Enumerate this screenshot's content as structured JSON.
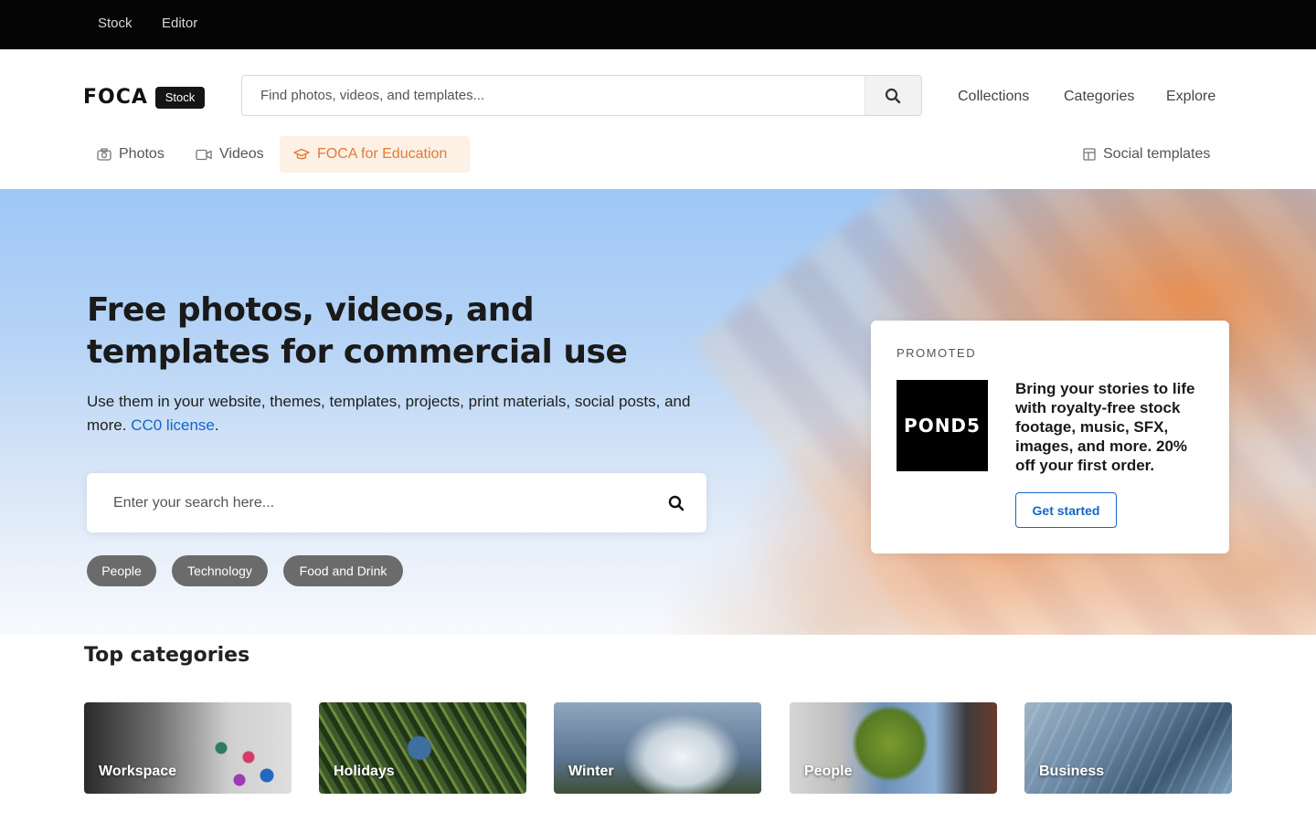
{
  "topbar": {
    "links": [
      "Stock",
      "Editor"
    ]
  },
  "header": {
    "logo": "FOCA",
    "logo_badge": "Stock",
    "search_placeholder": "Find photos, videos, and templates...",
    "nav": [
      "Collections",
      "Categories",
      "Explore"
    ],
    "subnav": {
      "photos": "Photos",
      "videos": "Videos",
      "education": "FOCA for Education",
      "social": "Social templates"
    }
  },
  "hero": {
    "title": "Free photos, videos, and templates for commercial use",
    "subtitle": "Use them in your website, themes, templates, projects, print materials, social posts, and more.",
    "license_link": "CC0 license",
    "license_suffix": ".",
    "search_placeholder": "Enter your search here...",
    "chips": [
      "People",
      "Technology",
      "Food and Drink"
    ]
  },
  "promo": {
    "label": "PROMOTED",
    "logo": "POND5",
    "text": "Bring your stories to life with royalty-free stock footage, music, SFX, images, and more. 20% off your first order.",
    "button": "Get started"
  },
  "categories": {
    "title": "Top categories",
    "items": [
      "Workspace",
      "Holidays",
      "Winter",
      "People",
      "Business"
    ]
  },
  "colors": {
    "accent": "#1466c8",
    "education": "#e07b39",
    "topbar": "#050505"
  }
}
